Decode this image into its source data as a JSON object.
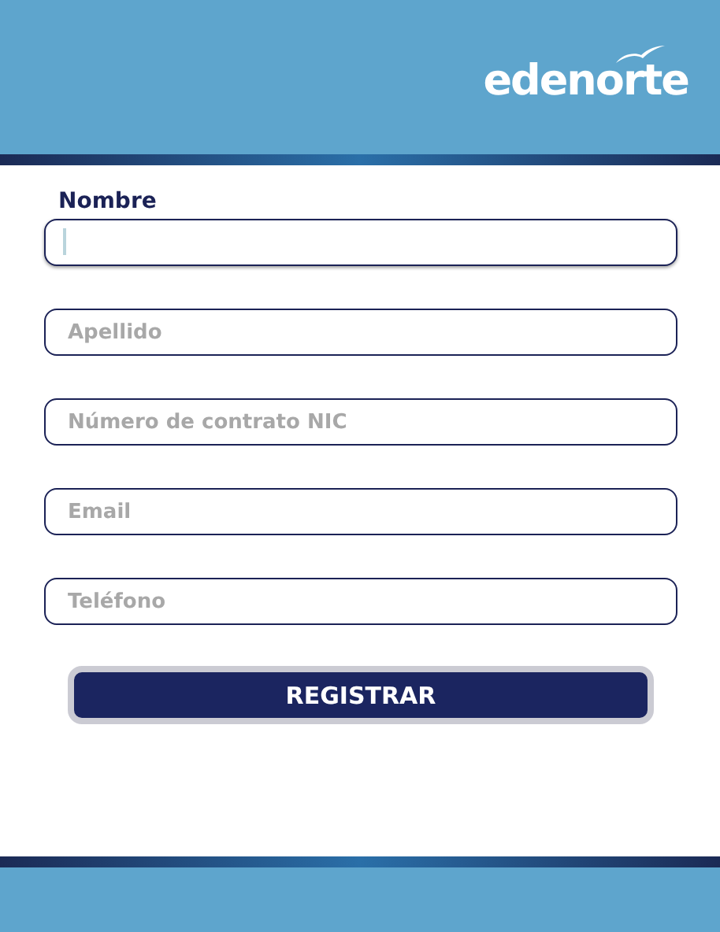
{
  "header": {
    "logo": "edenorte"
  },
  "form": {
    "fields": [
      {
        "label": "Nombre",
        "focused": true
      },
      {
        "placeholder": "Apellido",
        "focused": false
      },
      {
        "placeholder": "Número de contrato NIC",
        "focused": false
      },
      {
        "placeholder": "Email",
        "focused": false
      },
      {
        "placeholder": "Teléfono",
        "focused": false
      }
    ],
    "submit": "REGISTRAR"
  }
}
